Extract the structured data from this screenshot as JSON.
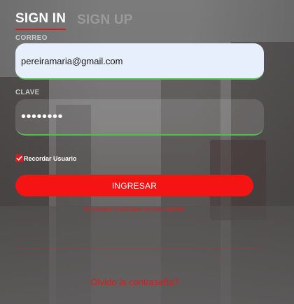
{
  "tabs": {
    "sign_in": "SIGN IN",
    "sign_up": "SIGN UP"
  },
  "form": {
    "email_label": "CORREO",
    "email_value": "pereiramaria@gmail.com",
    "password_label": "CLAVE",
    "password_value": "••••••••",
    "remember_label": "Recordar Usuario",
    "remember_checked": true,
    "submit_label": "INGRESAR",
    "error_message": "El usuario o la Clave no son validas",
    "forgot_link": "Olvido la contraseña?"
  },
  "colors": {
    "accent": "#f51414",
    "error_text": "#e41b1b",
    "input_focus_border": "#5fb75b",
    "email_field_bg": "#e8effc"
  },
  "icons": {
    "checkbox": "check-icon"
  }
}
